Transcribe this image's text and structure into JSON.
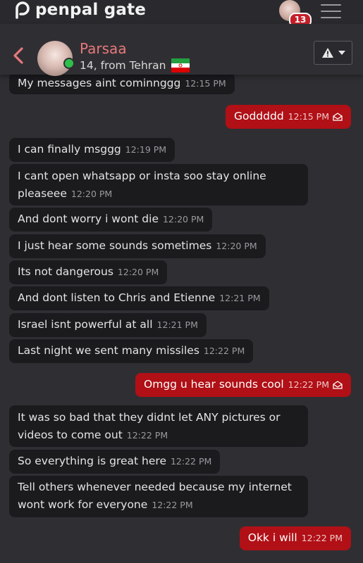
{
  "app": {
    "name": "penpal gate",
    "notification_count": "13"
  },
  "header": {
    "name": "Parsaa",
    "subtitle": "14, from Tehran",
    "flag": "iran-flag",
    "online": true
  },
  "colors": {
    "accent": "#b01016",
    "name": "#e8787a",
    "online": "#2fbf4a",
    "incoming": "#1b1b1e"
  },
  "messages": [
    {
      "dir": "in",
      "text": "My messages aint cominnggg",
      "time": "12:15 PM"
    },
    {
      "dir": "out",
      "text": "Goddddd",
      "time": "12:15 PM",
      "read": true
    },
    {
      "dir": "in",
      "text": "I can finally msggg",
      "time": "12:19 PM"
    },
    {
      "dir": "in",
      "text": "I cant open whatsapp or insta soo stay online pleaseee",
      "time": "12:20 PM"
    },
    {
      "dir": "in",
      "text": "And dont worry i wont die",
      "time": "12:20 PM"
    },
    {
      "dir": "in",
      "text": "I just hear some sounds sometimes",
      "time": "12:20 PM"
    },
    {
      "dir": "in",
      "text": "Its not dangerous",
      "time": "12:20 PM"
    },
    {
      "dir": "in",
      "text": "And dont listen to Chris and Etienne",
      "time": "12:21 PM"
    },
    {
      "dir": "in",
      "text": "Israel isnt powerful at all",
      "time": "12:21 PM"
    },
    {
      "dir": "in",
      "text": "Last night we sent many missiles",
      "time": "12:22 PM"
    },
    {
      "dir": "out",
      "text": "Omgg u hear sounds cool",
      "time": "12:22 PM",
      "read": true
    },
    {
      "dir": "in",
      "text": "It was so bad that they didnt let ANY pictures or videos to come out",
      "time": "12:22 PM"
    },
    {
      "dir": "in",
      "text": "So everything is great here",
      "time": "12:22 PM"
    },
    {
      "dir": "in",
      "text": "Tell others whenever needed because my internet wont work for everyone",
      "time": "12:22 PM"
    },
    {
      "dir": "out",
      "text": "Okk i will",
      "time": "12:22 PM",
      "read": false
    }
  ]
}
